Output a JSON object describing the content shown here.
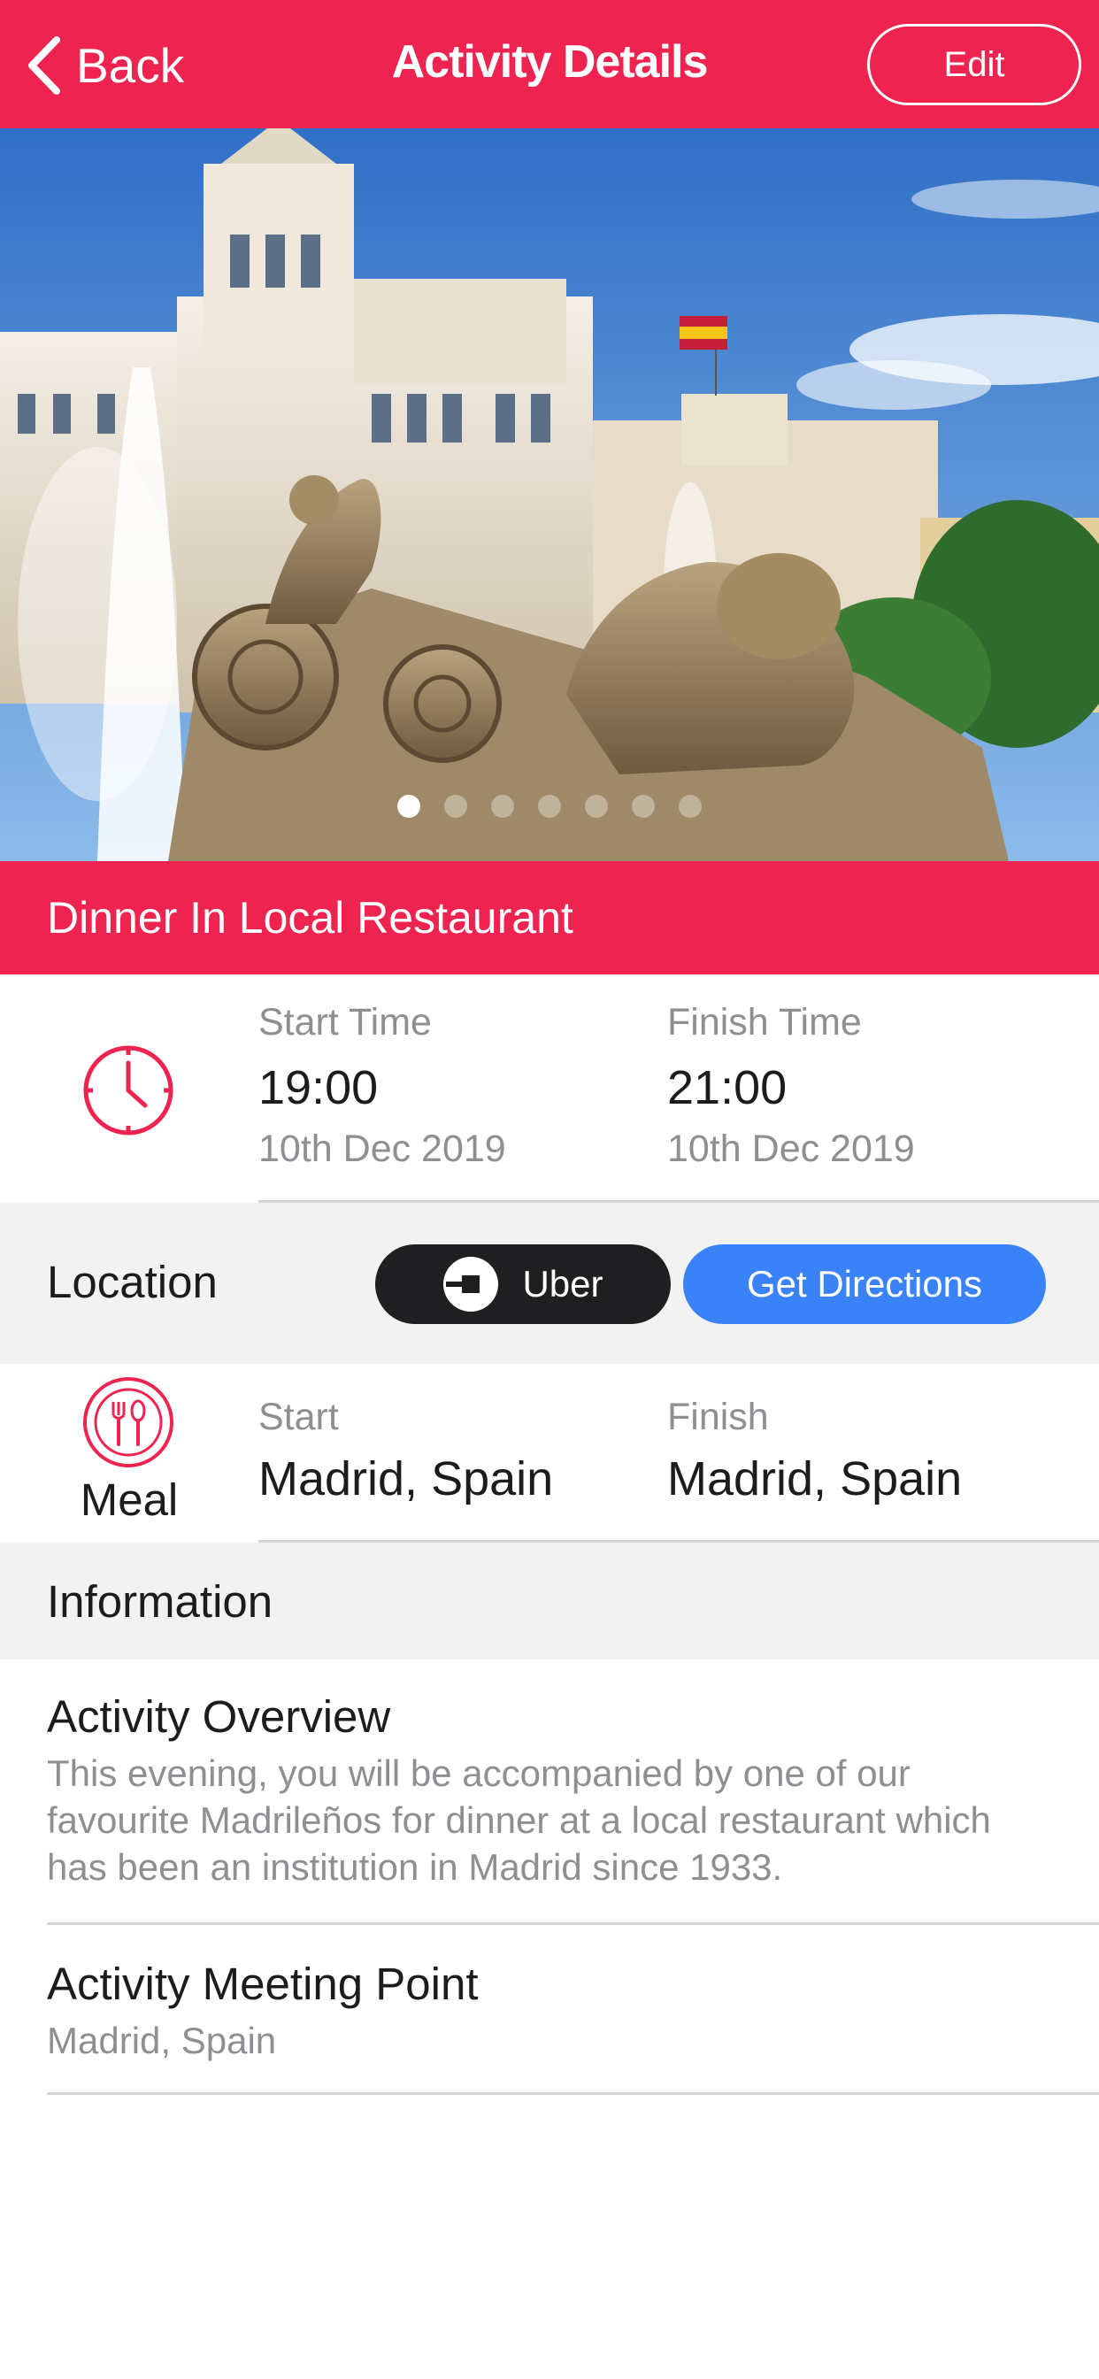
{
  "header": {
    "back_label": "Back",
    "title": "Activity Details",
    "edit_label": "Edit"
  },
  "hero": {
    "image_description": "Cibeles fountain, Madrid",
    "slides_count": 7,
    "active_slide": 1
  },
  "activity": {
    "name": "Dinner In Local Restaurant"
  },
  "time": {
    "start_label": "Start Time",
    "start_time": "19:00",
    "start_date": "10th Dec 2019",
    "finish_label": "Finish Time",
    "finish_time": "21:00",
    "finish_date": "10th Dec 2019"
  },
  "location": {
    "label": "Location",
    "uber_label": "Uber",
    "directions_label": "Get Directions",
    "category": "Meal",
    "start_label": "Start",
    "start_value": "Madrid, Spain",
    "finish_label": "Finish",
    "finish_value": "Madrid, Spain"
  },
  "information": {
    "header": "Information",
    "overview_title": "Activity Overview",
    "overview_text": "This evening, you will be accompanied by one of our favourite Madrileños for dinner at a local restaurant which has been an institution in Madrid since 1933.",
    "meeting_title": "Activity Meeting Point",
    "meeting_text": "Madrid, Spain"
  },
  "colors": {
    "brand_red": "#ee2350",
    "uber_black": "#1f1f22",
    "directions_blue": "#3a82f7",
    "section_grey": "#f2f2f2"
  }
}
